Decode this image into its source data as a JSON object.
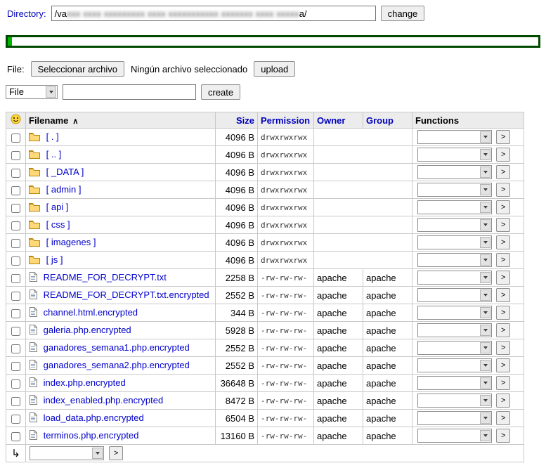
{
  "header": {
    "directory_label": "Directory:",
    "directory_value_prefix": "/va",
    "directory_value_redacted": "xxx xxxx xxxxxxxxx xxxx xxxxxxxxxxx xxxxxxx xxxx xxxxx",
    "directory_value_suffix": "a/",
    "change_button": "change"
  },
  "upload": {
    "file_label": "File:",
    "choose_file_button": "Seleccionar archivo",
    "no_file_text": "Ningún archivo seleccionado",
    "upload_button": "upload"
  },
  "create": {
    "type_selected": "File",
    "name_value": "",
    "create_button": "create"
  },
  "table": {
    "headers": {
      "filename": "Filename",
      "sort_indicator": "∧",
      "size": "Size",
      "permission": "Permission",
      "owner": "Owner",
      "group": "Group",
      "functions": "Functions"
    },
    "execute_button": ">",
    "rows": [
      {
        "type": "folder",
        "name": "[ . ]",
        "size": "4096 B",
        "permission": "drwxrwxrwx",
        "owner": "",
        "group": ""
      },
      {
        "type": "folder",
        "name": "[ .. ]",
        "size": "4096 B",
        "permission": "drwxrwxrwx",
        "owner": "",
        "group": ""
      },
      {
        "type": "folder",
        "name": "[ _DATA ]",
        "size": "4096 B",
        "permission": "drwxrwxrwx",
        "owner": "",
        "group": ""
      },
      {
        "type": "folder",
        "name": "[ admin ]",
        "size": "4096 B",
        "permission": "drwxrwxrwx",
        "owner": "",
        "group": ""
      },
      {
        "type": "folder",
        "name": "[ api ]",
        "size": "4096 B",
        "permission": "drwxrwxrwx",
        "owner": "",
        "group": ""
      },
      {
        "type": "folder",
        "name": "[ css ]",
        "size": "4096 B",
        "permission": "drwxrwxrwx",
        "owner": "",
        "group": ""
      },
      {
        "type": "folder",
        "name": "[ imagenes ]",
        "size": "4096 B",
        "permission": "drwxrwxrwx",
        "owner": "",
        "group": ""
      },
      {
        "type": "folder",
        "name": "[ js ]",
        "size": "4096 B",
        "permission": "drwxrwxrwx",
        "owner": "",
        "group": ""
      },
      {
        "type": "file",
        "name": "README_FOR_DECRYPT.txt",
        "size": "2258 B",
        "permission": "-rw-rw-rw-",
        "owner": "apache",
        "group": "apache"
      },
      {
        "type": "file",
        "name": "README_FOR_DECRYPT.txt.encrypted",
        "size": "2552 B",
        "permission": "-rw-rw-rw-",
        "owner": "apache",
        "group": "apache"
      },
      {
        "type": "file",
        "name": "channel.html.encrypted",
        "size": "344 B",
        "permission": "-rw-rw-rw-",
        "owner": "apache",
        "group": "apache"
      },
      {
        "type": "file",
        "name": "galeria.php.encrypted",
        "size": "5928 B",
        "permission": "-rw-rw-rw-",
        "owner": "apache",
        "group": "apache"
      },
      {
        "type": "file",
        "name": "ganadores_semana1.php.encrypted",
        "size": "2552 B",
        "permission": "-rw-rw-rw-",
        "owner": "apache",
        "group": "apache"
      },
      {
        "type": "file",
        "name": "ganadores_semana2.php.encrypted",
        "size": "2552 B",
        "permission": "-rw-rw-rw-",
        "owner": "apache",
        "group": "apache"
      },
      {
        "type": "file",
        "name": "index.php.encrypted",
        "size": "36648 B",
        "permission": "-rw-rw-rw-",
        "owner": "apache",
        "group": "apache"
      },
      {
        "type": "file",
        "name": "index_enabled.php.encrypted",
        "size": "8472 B",
        "permission": "-rw-rw-rw-",
        "owner": "apache",
        "group": "apache"
      },
      {
        "type": "file",
        "name": "load_data.php.encrypted",
        "size": "6504 B",
        "permission": "-rw-rw-rw-",
        "owner": "apache",
        "group": "apache"
      },
      {
        "type": "file",
        "name": "terminos.php.encrypted",
        "size": "13160 B",
        "permission": "-rw-rw-rw-",
        "owner": "apache",
        "group": "apache"
      }
    ]
  },
  "footer": {
    "arrow": "↳",
    "execute_button": ">"
  }
}
